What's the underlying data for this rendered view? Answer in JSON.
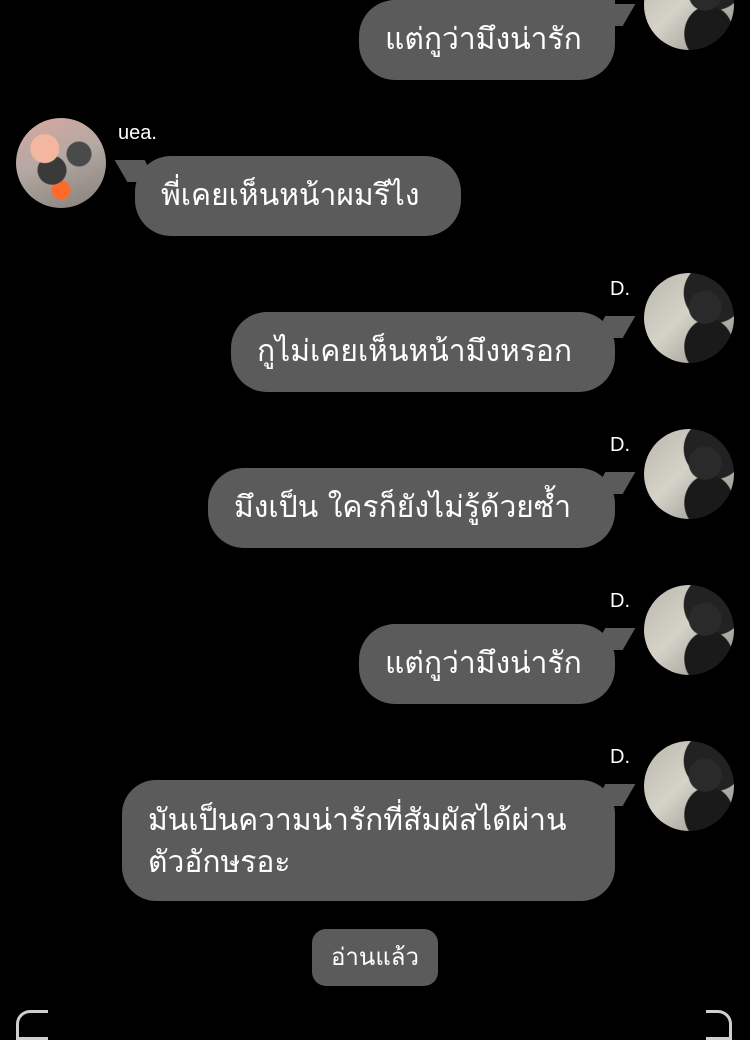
{
  "messages": [
    {
      "sender": "D.",
      "side": "right",
      "text": "แต่กูว่ามึงน่ารัก",
      "show_name": false
    },
    {
      "sender": "uea.",
      "side": "left",
      "text": "พี่เคยเห็นหน้าผมรึไง",
      "show_name": true
    },
    {
      "sender": "D.",
      "side": "right",
      "text": "กูไม่เคยเห็นหน้ามึงหรอก",
      "show_name": true
    },
    {
      "sender": "D.",
      "side": "right",
      "text": "มึงเป็น ใครก็ยังไม่รู้ด้วยซ้ำ",
      "show_name": true
    },
    {
      "sender": "D.",
      "side": "right",
      "text": "แต่กูว่ามึงน่ารัก",
      "show_name": true
    },
    {
      "sender": "D.",
      "side": "right",
      "text_line1": "มันเป็นความน่ารักที่สัมผัสได้ผ่าน",
      "text_line2": "ตัวอักษรอะ",
      "show_name": true
    }
  ],
  "read_status": "อ่านแล้ว",
  "colors": {
    "background": "#000000",
    "bubble": "#5b5b5b",
    "text": "#ffffff"
  }
}
